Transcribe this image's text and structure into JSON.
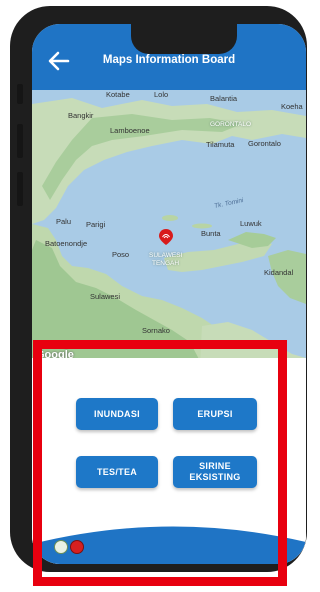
{
  "header": {
    "title": "Maps Information Board"
  },
  "map": {
    "labels": {
      "kotabe": "Kotabe",
      "lolo": "Lolo",
      "balantia": "Balantia",
      "koeha": "Koeha",
      "bangkir": "Bangkir",
      "lamboenoe": "Lamboenoe",
      "gorontalo_region": "GORONTALO",
      "tilamuta": "Tilamuta",
      "gorontalo": "Gorontalo",
      "tomini": "Tk. Tomini",
      "palu": "Palu",
      "parigi": "Parigi",
      "bunta": "Bunta",
      "luwuk": "Luwuk",
      "batoenondje": "Batoenondje",
      "poso": "Poso",
      "sulawesi_tengah_1": "SULAWESI",
      "sulawesi_tengah_2": "TENGAH",
      "kidandal": "Kidandal",
      "sulawesi": "Sulawesi",
      "sornako": "Sornako"
    },
    "attribution": "Google"
  },
  "buttons": {
    "inundasi": "INUNDASI",
    "erupsi": "ERUPSI",
    "tes_tea": "TES/TEA",
    "sirine_line1": "SIRINE",
    "sirine_line2": "EKSISTING"
  },
  "colors": {
    "primary": "#1f74c5",
    "button": "#1e78c8",
    "highlight": "#e8000f",
    "marker": "#d81b1b"
  },
  "icons": {
    "back": "arrow-left-icon",
    "marker": "location-marker-icon"
  }
}
